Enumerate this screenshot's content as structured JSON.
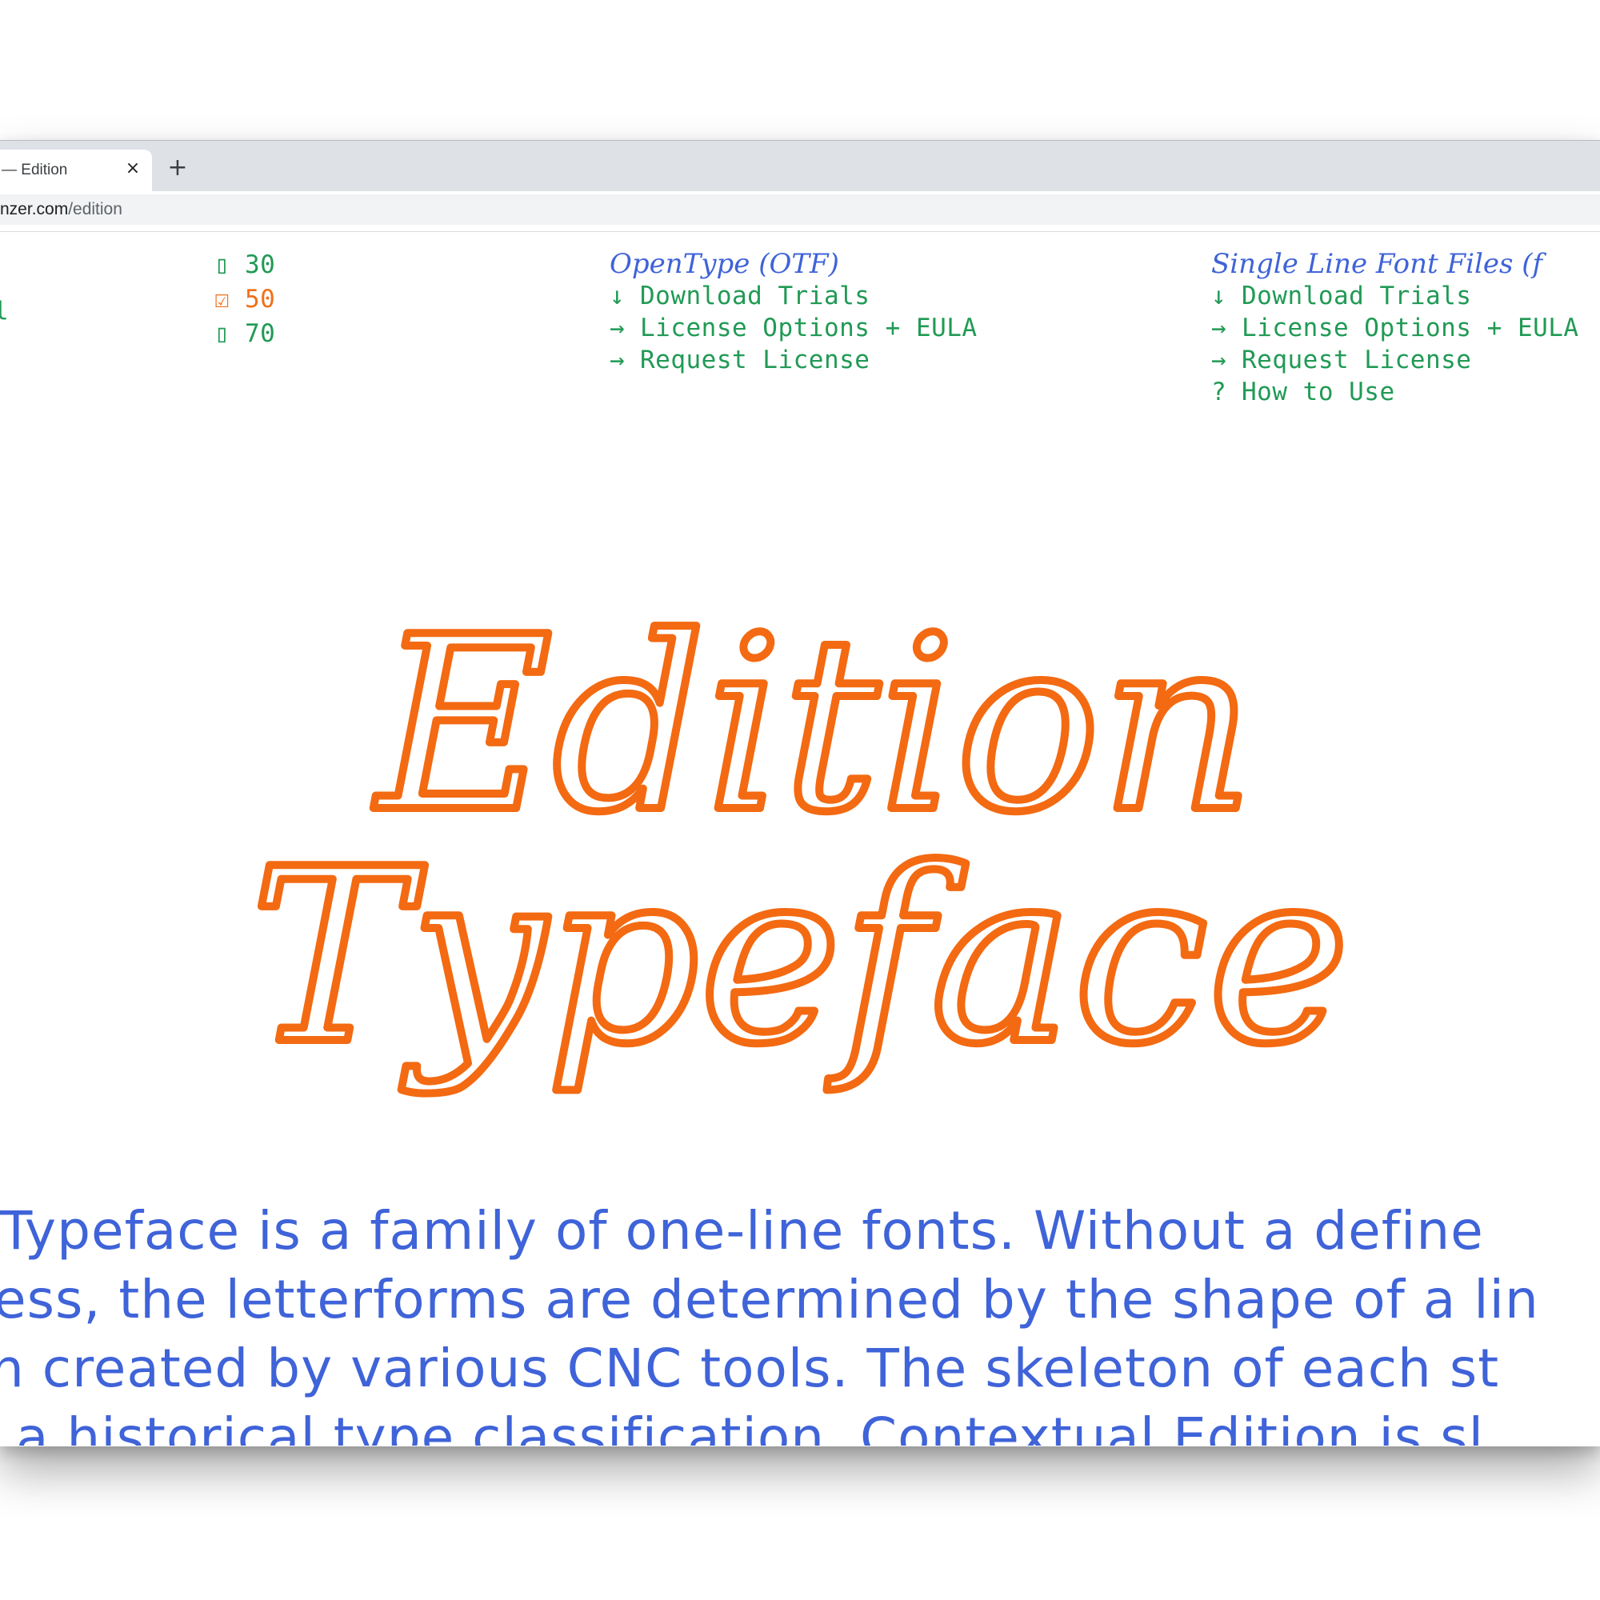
{
  "browser": {
    "tab_title": "— Edition",
    "tab_close": "×",
    "new_tab": "+",
    "url_host": "nzer.com",
    "url_path": "/edition"
  },
  "weights": [
    {
      "checkbox": "▯",
      "value": "30",
      "selected": false
    },
    {
      "checkbox": "☑",
      "value": "50",
      "selected": true
    },
    {
      "checkbox": "▯",
      "value": "70",
      "selected": false
    }
  ],
  "left_fragment": "l",
  "opentype": {
    "heading": "OpenType (OTF)",
    "links": [
      {
        "glyph": "↓",
        "label": "Download Trials"
      },
      {
        "glyph": "→",
        "label": "License Options + EULA"
      },
      {
        "glyph": "→",
        "label": "Request License"
      }
    ]
  },
  "single_line": {
    "heading": "Single Line Font Files (f",
    "links": [
      {
        "glyph": "↓",
        "label": "Download Trials"
      },
      {
        "glyph": "→",
        "label": "License Options + EULA"
      },
      {
        "glyph": "→",
        "label": "Request License"
      },
      {
        "glyph": "?",
        "label": "How to Use"
      }
    ]
  },
  "hero": {
    "line1": "Edition",
    "line2": "Typeface"
  },
  "description": [
    " Typeface is a family of one-line fonts. Without a define",
    "ess, the letterforms are determined by the shape of a lin",
    "h created by various CNC tools. The skeleton of each st",
    "a historical type classification. Contextual Edition is sl"
  ],
  "colors": {
    "green": "#219a55",
    "orange": "#f36a12",
    "blue": "#3f63d8"
  }
}
